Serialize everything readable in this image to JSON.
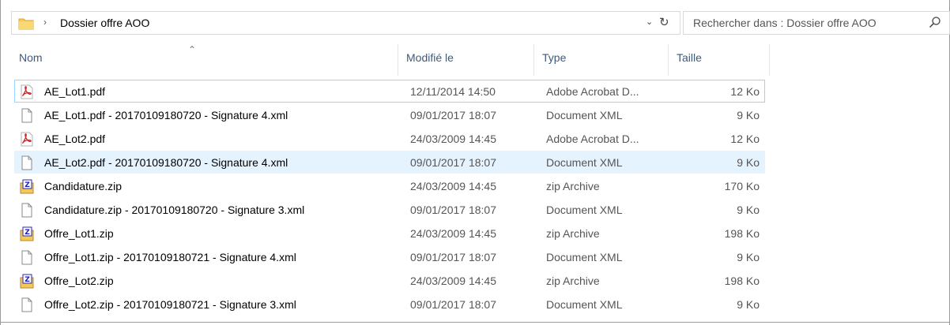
{
  "address": {
    "path": "Dossier offre AOO",
    "separator": "›"
  },
  "search": {
    "placeholder": "Rechercher dans : Dossier offre AOO"
  },
  "columns": {
    "name": "Nom",
    "modified": "Modifié le",
    "type": "Type",
    "size": "Taille"
  },
  "files": [
    {
      "name": "AE_Lot1.pdf",
      "modified": "12/11/2014 14:50",
      "type": "Adobe Acrobat D...",
      "size": "12 Ko",
      "icon": "pdf-icon",
      "state": "selected"
    },
    {
      "name": "AE_Lot1.pdf - 20170109180720 - Signature 4.xml",
      "modified": "09/01/2017 18:07",
      "type": "Document XML",
      "size": "9 Ko",
      "icon": "xml-file-icon",
      "state": ""
    },
    {
      "name": "AE_Lot2.pdf",
      "modified": "24/03/2009 14:45",
      "type": "Adobe Acrobat D...",
      "size": "12 Ko",
      "icon": "pdf-icon",
      "state": ""
    },
    {
      "name": "AE_Lot2.pdf - 20170109180720 - Signature 4.xml",
      "modified": "09/01/2017 18:07",
      "type": "Document XML",
      "size": "9 Ko",
      "icon": "xml-file-icon",
      "state": "hover"
    },
    {
      "name": "Candidature.zip",
      "modified": "24/03/2009 14:45",
      "type": "zip Archive",
      "size": "170 Ko",
      "icon": "zip-icon",
      "state": ""
    },
    {
      "name": "Candidature.zip - 20170109180720 - Signature 3.xml",
      "modified": "09/01/2017 18:07",
      "type": "Document XML",
      "size": "9 Ko",
      "icon": "xml-file-icon",
      "state": ""
    },
    {
      "name": "Offre_Lot1.zip",
      "modified": "24/03/2009 14:45",
      "type": "zip Archive",
      "size": "198 Ko",
      "icon": "zip-icon",
      "state": ""
    },
    {
      "name": "Offre_Lot1.zip - 20170109180721 - Signature 4.xml",
      "modified": "09/01/2017 18:07",
      "type": "Document XML",
      "size": "9 Ko",
      "icon": "xml-file-icon",
      "state": ""
    },
    {
      "name": "Offre_Lot2.zip",
      "modified": "24/03/2009 14:45",
      "type": "zip Archive",
      "size": "198 Ko",
      "icon": "zip-icon",
      "state": ""
    },
    {
      "name": "Offre_Lot2.zip - 20170109180721 - Signature 3.xml",
      "modified": "09/01/2017 18:07",
      "type": "Document XML",
      "size": "9 Ko",
      "icon": "xml-file-icon",
      "state": ""
    }
  ],
  "colors": {
    "selection_border": "#99d1ff",
    "hover_fill": "#e5f3ff",
    "header_text": "#3c5a7a"
  }
}
